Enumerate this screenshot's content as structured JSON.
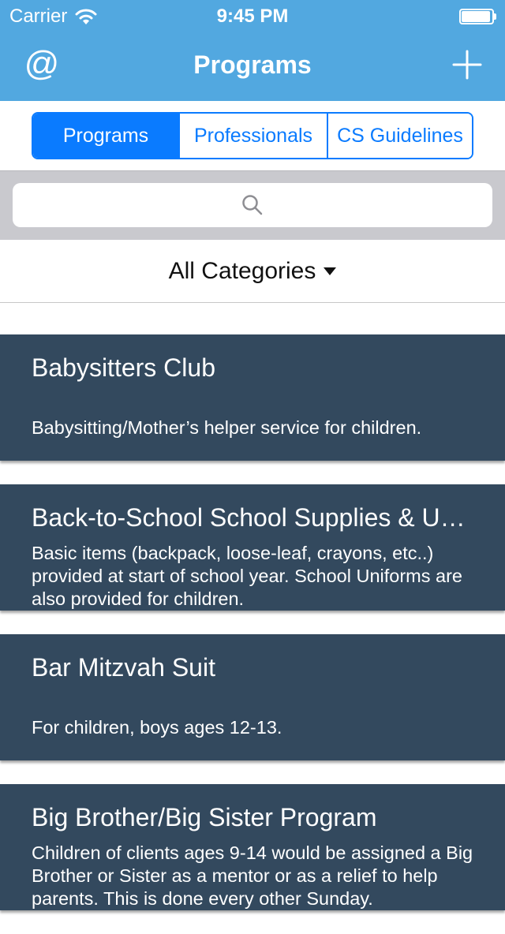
{
  "status_bar": {
    "carrier": "Carrier",
    "time": "9:45 PM"
  },
  "nav": {
    "title": "Programs",
    "left_icon": "at-icon",
    "right_icon": "plus-icon"
  },
  "segments": [
    {
      "label": "Programs",
      "selected": true
    },
    {
      "label": "Professionals",
      "selected": false
    },
    {
      "label": "CS Guidelines",
      "selected": false
    }
  ],
  "search": {
    "placeholder": "",
    "icon": "search-icon"
  },
  "filter": {
    "label": "All Categories"
  },
  "programs": [
    {
      "title": "Babysitters Club",
      "description": "Babysitting/Mother’s helper service for children."
    },
    {
      "title": "Back-to-School School Supplies & Uniforms",
      "description": "Basic items (backpack, loose-leaf, crayons, etc..) provided at start of school year. School Uniforms are also provided for children."
    },
    {
      "title": "Bar Mitzvah Suit",
      "description": "For children, boys ages 12-13."
    },
    {
      "title": "Big Brother/Big Sister Program",
      "description": "Children of clients ages 9-14 would be assigned a Big Brother or Sister as a mentor or as a relief to help parents. This is done every other Sunday."
    }
  ],
  "colors": {
    "nav_bar": "#52a8e0",
    "segment_accent": "#0a7bff",
    "card_background": "#33495e",
    "search_bar_background": "#c9c9ce"
  }
}
